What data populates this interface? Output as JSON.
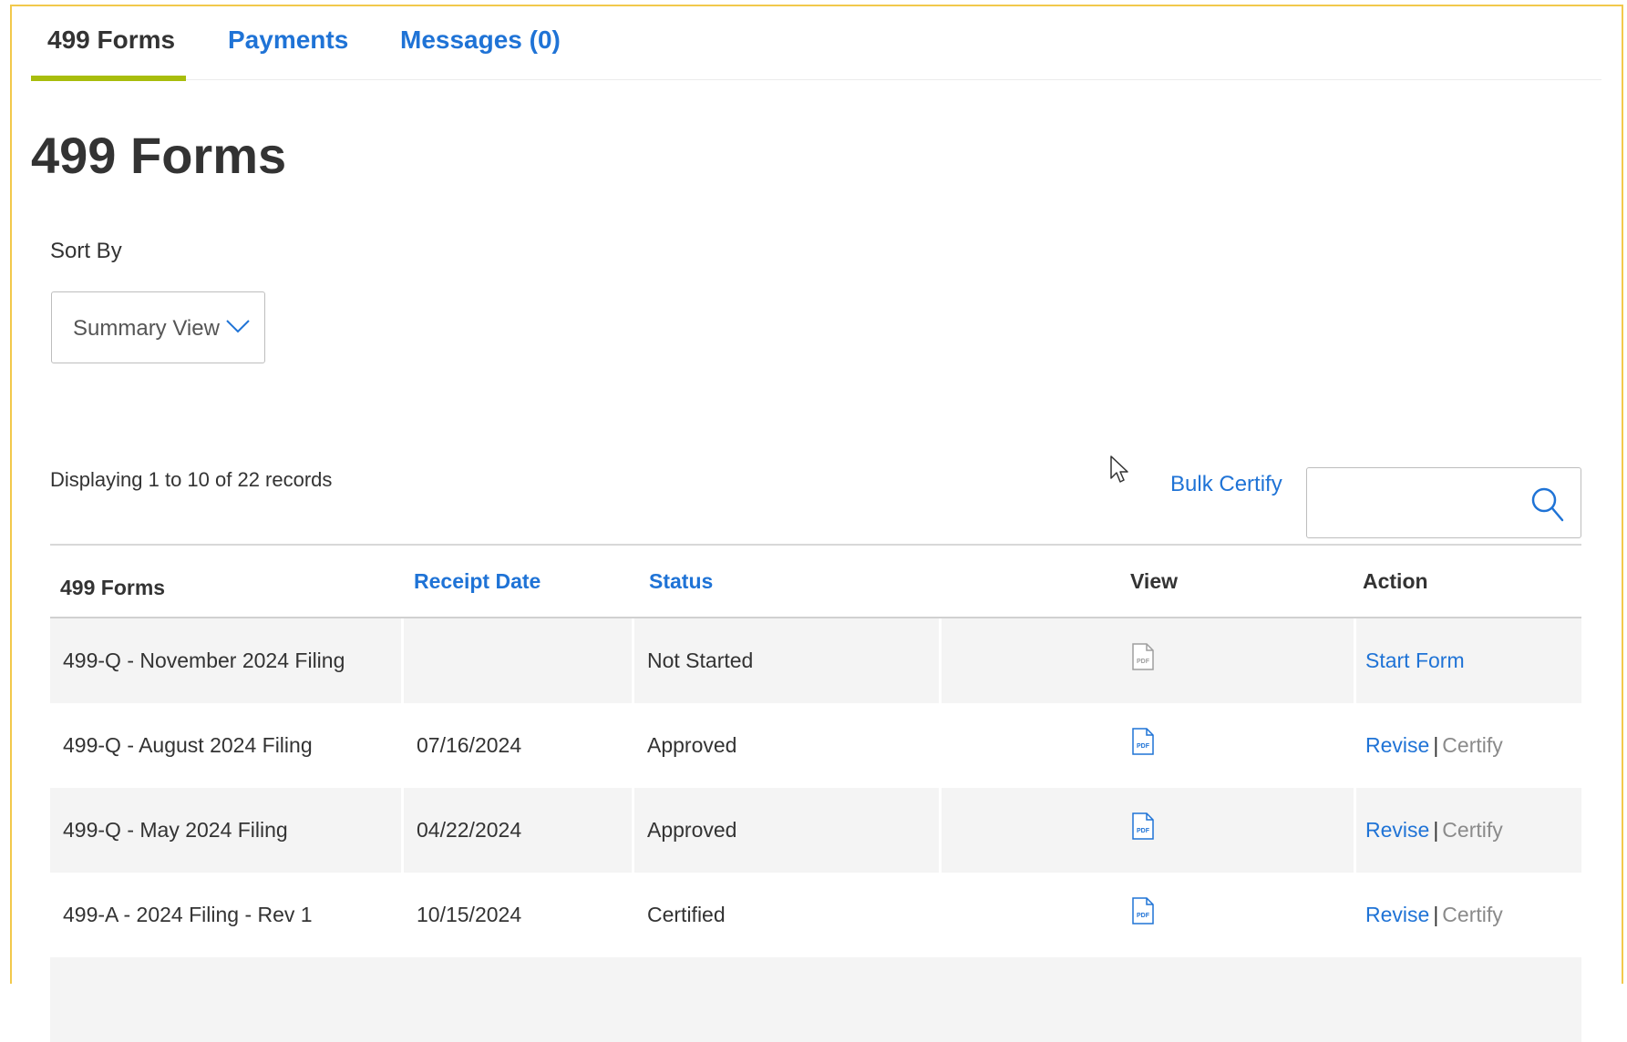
{
  "tabs": [
    {
      "label": "499 Forms"
    },
    {
      "label": "Payments"
    },
    {
      "label": "Messages (0)"
    }
  ],
  "page_title": "499 Forms",
  "sort": {
    "label": "Sort By",
    "value": "Summary View"
  },
  "records_text": "Displaying 1 to 10 of 22 records",
  "bulk_certify": "Bulk Certify",
  "search": {
    "value": "",
    "placeholder": ""
  },
  "table": {
    "headers": {
      "form": "499 Forms",
      "receipt_date": "Receipt Date",
      "status": "Status",
      "view": "View",
      "action": "Action"
    },
    "rows": [
      {
        "form": "499-Q - November 2024 Filing",
        "receipt_date": "",
        "status": "Not Started",
        "pdf_icon": "pdf-file-icon-disabled",
        "action": "Start Form",
        "sep": "",
        "action2": ""
      },
      {
        "form": "499-Q - August 2024 Filing",
        "receipt_date": "07/16/2024",
        "status": "Approved",
        "pdf_icon": "pdf-file-icon",
        "action": "Revise",
        "sep": "|",
        "action2": "Certify"
      },
      {
        "form": "499-Q - May 2024 Filing",
        "receipt_date": "04/22/2024",
        "status": "Approved",
        "pdf_icon": "pdf-file-icon",
        "action": "Revise",
        "sep": "|",
        "action2": "Certify"
      },
      {
        "form": "499-A - 2024 Filing - Rev 1",
        "receipt_date": "10/15/2024",
        "status": "Certified",
        "pdf_icon": "pdf-file-icon",
        "action": "Revise",
        "sep": "|",
        "action2": "Certify"
      }
    ]
  },
  "colors": {
    "accent": "#1f73d6",
    "tab_indicator": "#a8bd0c",
    "frame": "#f2c94c",
    "row_alt": "#f4f4f4",
    "disabled_text": "#8a8a8a"
  }
}
